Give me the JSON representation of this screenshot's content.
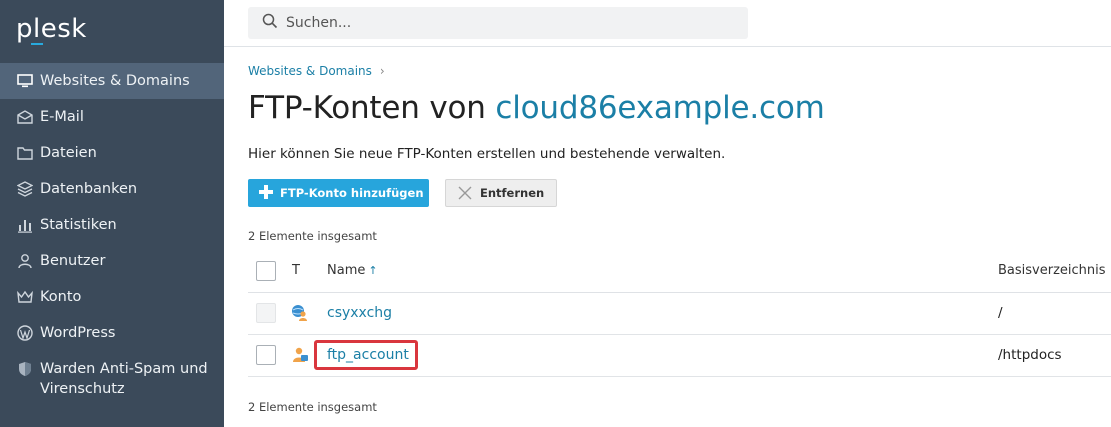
{
  "sidebar": {
    "logo": "plesk",
    "items": [
      {
        "label": "Websites & Domains",
        "icon": "monitor-icon",
        "active": true
      },
      {
        "label": "E-Mail",
        "icon": "envelope-icon"
      },
      {
        "label": "Dateien",
        "icon": "folder-icon"
      },
      {
        "label": "Datenbanken",
        "icon": "database-icon"
      },
      {
        "label": "Statistiken",
        "icon": "bar-chart-icon"
      },
      {
        "label": "Benutzer",
        "icon": "user-icon"
      },
      {
        "label": "Konto",
        "icon": "crown-icon"
      },
      {
        "label": "WordPress",
        "icon": "wordpress-icon"
      },
      {
        "label": "Warden Anti-Spam und Virenschutz",
        "icon": "shield-icon"
      }
    ]
  },
  "search": {
    "placeholder": "Suchen..."
  },
  "breadcrumb": {
    "item": "Websites & Domains",
    "separator": "›"
  },
  "page": {
    "title_prefix": "FTP-Konten von",
    "title_domain": "cloud86example.com",
    "description": "Hier können Sie neue FTP-Konten erstellen und bestehende verwalten."
  },
  "toolbar": {
    "add_label": "FTP-Konto hinzufügen",
    "remove_label": "Entfernen"
  },
  "list": {
    "total_label": "2 Elemente insgesamt",
    "columns": {
      "type": "T",
      "name": "Name",
      "sort_arrow": "↑",
      "base_dir": "Basisverzeichnis"
    },
    "rows": [
      {
        "name": "csyxxchg",
        "base_dir": "/",
        "icon": "ftp-globe-user-icon",
        "checkbox_disabled": true
      },
      {
        "name": "ftp_account",
        "base_dir": "/httpdocs",
        "icon": "ftp-user-icon",
        "checkbox_disabled": false,
        "highlighted": true
      }
    ]
  },
  "colors": {
    "sidebar_bg": "#3b4a5a",
    "sidebar_active": "#52657a",
    "accent": "#27a5dc",
    "link": "#1b7fa6",
    "highlight": "#d9363e"
  }
}
